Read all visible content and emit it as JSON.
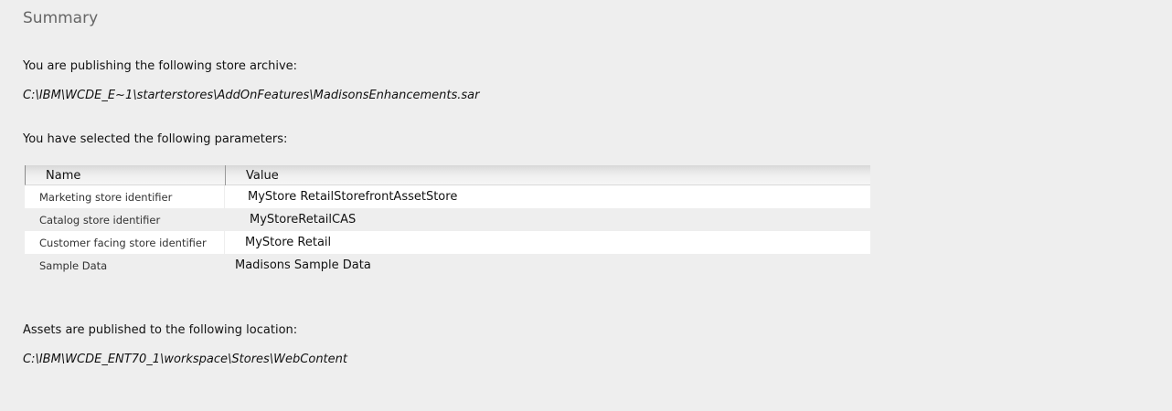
{
  "summary": {
    "title": "Summary",
    "archive_intro": "You are publishing the following store archive:",
    "archive_path": "C:\\IBM\\WCDE_E~1\\starterstores\\AddOnFeatures\\MadisonsEnhancements.sar",
    "params_intro": "You have selected the following parameters:",
    "assets_intro": "Assets are published to the following location:",
    "assets_path": "C:\\IBM\\WCDE_ENT70_1\\workspace\\Stores\\WebContent"
  },
  "table": {
    "headers": {
      "name": "Name",
      "value": "Value"
    },
    "rows": [
      {
        "name": "Marketing store identifier",
        "value": "MyStore RetailStorefrontAssetStore"
      },
      {
        "name": "Catalog store identifier",
        "value": "MyStoreRetailCAS"
      },
      {
        "name": "Customer facing store identifier",
        "value": "MyStore Retail"
      },
      {
        "name": "Sample Data",
        "value": "Madisons Sample Data"
      }
    ]
  }
}
